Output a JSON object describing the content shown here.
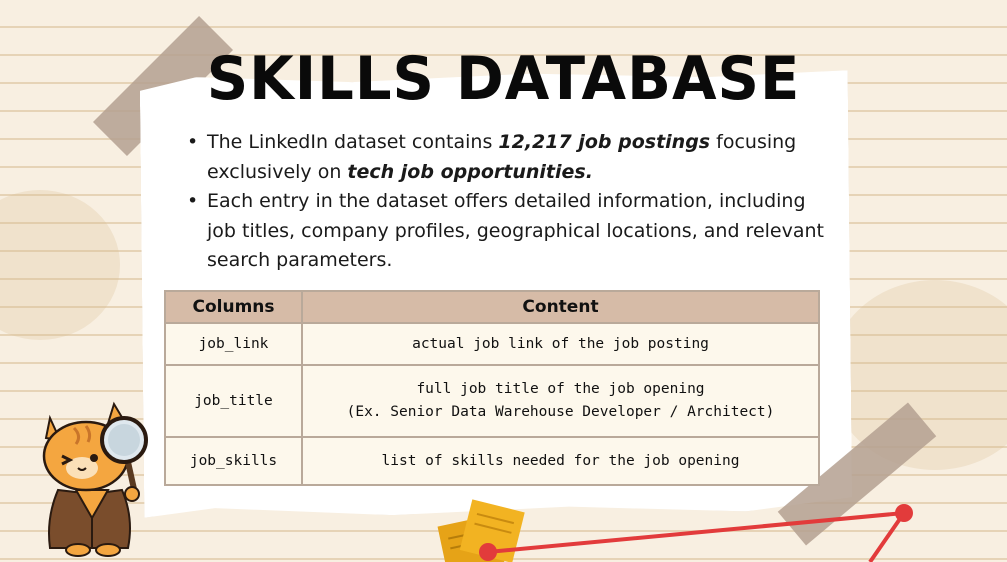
{
  "title": "SKILLS DATABASE",
  "bullets": [
    {
      "pre": "The LinkedIn dataset contains ",
      "em1": "12,217 job postings",
      "mid": " focusing exclusively on ",
      "em2": "tech job opportunities."
    },
    {
      "text": "Each entry in the dataset offers detailed information, including job titles, company profiles, geographical locations, and relevant search parameters."
    }
  ],
  "table": {
    "headers": [
      "Columns",
      "Content"
    ],
    "rows": [
      {
        "column": "job_link",
        "content": [
          "actual job link of the job posting"
        ]
      },
      {
        "column": "job_title",
        "content": [
          "full job title of the job opening",
          "(Ex. Senior Data Warehouse Developer / Architect)"
        ]
      },
      {
        "column": "job_skills",
        "content": [
          "list of skills needed for the job opening"
        ]
      }
    ]
  },
  "colors": {
    "background": "#f8efe1",
    "header_fill": "#d6bba7",
    "cell_fill": "#fdf8ec",
    "accent_red": "#e23b3b",
    "note_yellow": "#f2b322",
    "cat_orange": "#f0a030"
  },
  "decor": {
    "illustration": "detective-cat-with-magnifier-icon",
    "line_chart": "red-line-chart-icon",
    "notes": "sticky-notes-icon"
  }
}
